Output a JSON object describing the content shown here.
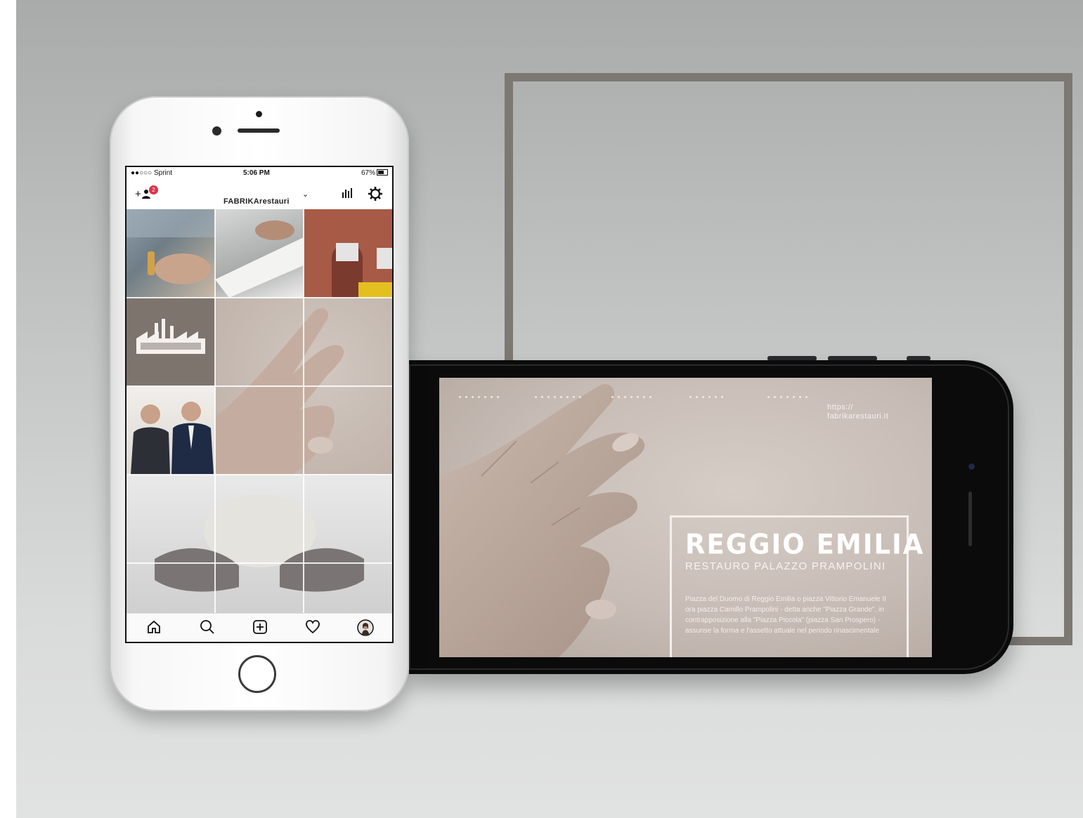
{
  "portrait_phone": {
    "status_bar": {
      "carrier": "●●○○○ Sprint",
      "time": "5:06 PM",
      "battery": "67%"
    },
    "header": {
      "username": "FABRIKArestauri",
      "notification_count": "2"
    },
    "bottom_nav": [
      "home-icon",
      "search-icon",
      "add-post-icon",
      "heart-icon",
      "profile-avatar"
    ]
  },
  "landscape_phone": {
    "url": "https://\nfabrikarestauri.it",
    "title": "REGGIO EMILIA",
    "subtitle": "RESTAURO PALAZZO PRAMPOLINI",
    "body": "Piazza del Duomo di Reggio Emilia o piazza Vittorio Emanuele II ora piazza Camillo Prampolini - detta anche \"Piazza Grande\", in contrapposizione alla \"Piazza Piccola\" (piazza San Prospero) - assunse la forma e l'assetto attuale nel periodo rinascimentale"
  },
  "colors": {
    "frame": "#7e7873",
    "badge": "#e0334a",
    "logo_tile": "#7d746d"
  }
}
